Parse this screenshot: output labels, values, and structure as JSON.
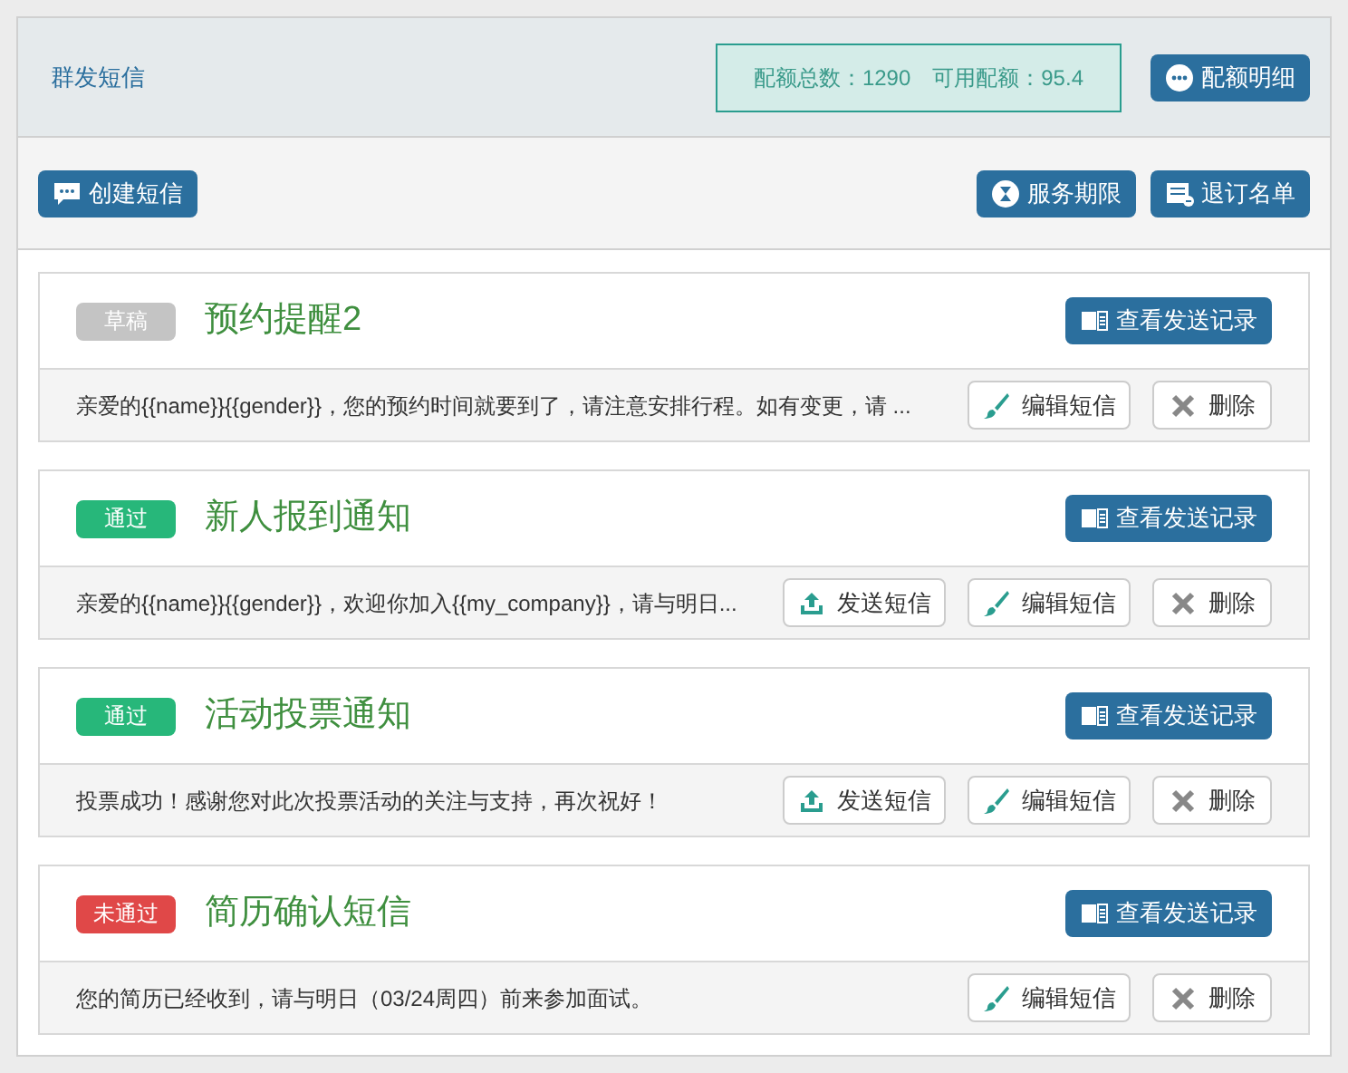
{
  "header": {
    "title": "群发短信",
    "quota": "配额总数：1290　可用配额：95.4",
    "quota_button": "配额明细"
  },
  "toolbar": {
    "create": "创建短信",
    "service": "服务期限",
    "unsubscribe": "退订名单"
  },
  "messages": [
    {
      "status": {
        "kind": "draft",
        "label": "草稿"
      },
      "title": "预约提醒2",
      "records_button": "查看发送记录",
      "text": "亲爱的{{name}}{{gender}}，您的预约时间就要到了，请注意安排行程。如有变更，请 ...",
      "actions": [
        {
          "kind": "edit",
          "label": "编辑短信"
        },
        {
          "kind": "delete",
          "label": "删除"
        }
      ]
    },
    {
      "status": {
        "kind": "approved",
        "label": "通过"
      },
      "title": "新人报到通知",
      "records_button": "查看发送记录",
      "text": "亲爱的{{name}}{{gender}}，欢迎你加入{{my_company}}，请与明日...",
      "actions": [
        {
          "kind": "send",
          "label": "发送短信"
        },
        {
          "kind": "edit",
          "label": "编辑短信"
        },
        {
          "kind": "delete",
          "label": "删除"
        }
      ]
    },
    {
      "status": {
        "kind": "approved",
        "label": "通过"
      },
      "title": "活动投票通知",
      "records_button": "查看发送记录",
      "text": "投票成功！感谢您对此次投票活动的关注与支持，再次祝好！",
      "actions": [
        {
          "kind": "send",
          "label": "发送短信"
        },
        {
          "kind": "edit",
          "label": "编辑短信"
        },
        {
          "kind": "delete",
          "label": "删除"
        }
      ]
    },
    {
      "status": {
        "kind": "rejected",
        "label": "未通过"
      },
      "title": "简历确认短信",
      "records_button": "查看发送记录",
      "text": "您的简历已经收到，请与明日（03/24周四）前来参加面试。",
      "actions": [
        {
          "kind": "edit",
          "label": "编辑短信"
        },
        {
          "kind": "delete",
          "label": "删除"
        }
      ]
    }
  ]
}
